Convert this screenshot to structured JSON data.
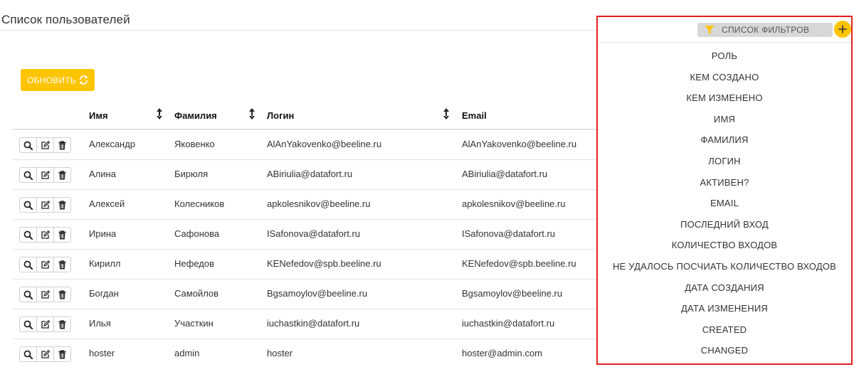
{
  "page": {
    "title": "Список пользователей"
  },
  "toolbar": {
    "refresh_label": "ОБНОВИТЬ",
    "refresh_icon": "refresh-icon",
    "accent_color": "#fdc400"
  },
  "table": {
    "columns": [
      {
        "label": "Имя",
        "sortable": true
      },
      {
        "label": "Фамилия",
        "sortable": true
      },
      {
        "label": "Логин",
        "sortable": true
      },
      {
        "label": "Email",
        "sortable": false
      }
    ],
    "row_actions": [
      "search-icon",
      "edit-icon",
      "trash-icon"
    ],
    "rows": [
      {
        "first_name": "Александр",
        "last_name": "Яковенко",
        "login": "AlAnYakovenko@beeline.ru",
        "email": "AlAnYakovenko@beeline.ru"
      },
      {
        "first_name": "Алина",
        "last_name": "Бирюля",
        "login": "ABiriulia@datafort.ru",
        "email": "ABiriulia@datafort.ru"
      },
      {
        "first_name": "Алексей",
        "last_name": "Колесников",
        "login": "apkolesnikov@beeline.ru",
        "email": "apkolesnikov@beeline.ru"
      },
      {
        "first_name": "Ирина",
        "last_name": "Сафонова",
        "login": "ISafonova@datafort.ru",
        "email": "ISafonova@datafort.ru"
      },
      {
        "first_name": "Кирилл",
        "last_name": "Нефедов",
        "login": "KENefedov@spb.beeline.ru",
        "email": "KENefedov@spb.beeline.ru"
      },
      {
        "first_name": "Богдан",
        "last_name": "Самойлов",
        "login": "Bgsamoylov@beeline.ru",
        "email": "Bgsamoylov@beeline.ru"
      },
      {
        "first_name": "Илья",
        "last_name": "Участкин",
        "login": "iuchastkin@datafort.ru",
        "email": "iuchastkin@datafort.ru"
      },
      {
        "first_name": "hoster",
        "last_name": "admin",
        "login": "hoster",
        "email": "hoster@admin.com"
      }
    ]
  },
  "filters": {
    "chip_label": "СПИСОК ФИЛЬТРОВ",
    "chip_icon": "filter-icon",
    "add_icon": "plus-icon",
    "highlight_color": "#e0201f",
    "items": [
      "РОЛЬ",
      "КЕМ СОЗДАНО",
      "КЕМ ИЗМЕНЕНО",
      "ИМЯ",
      "ФАМИЛИЯ",
      "ЛОГИН",
      "АКТИВЕН?",
      "EMAIL",
      "ПОСЛЕДНИЙ ВХОД",
      "КОЛИЧЕСТВО ВХОДОВ",
      "НЕ УДАЛОСЬ ПОСЧИАТЬ КОЛИЧЕСТВО ВХОДОВ",
      "ДАТА СОЗДАНИЯ",
      "ДАТА ИЗМЕНЕНИЯ",
      "CREATED",
      "CHANGED"
    ]
  }
}
